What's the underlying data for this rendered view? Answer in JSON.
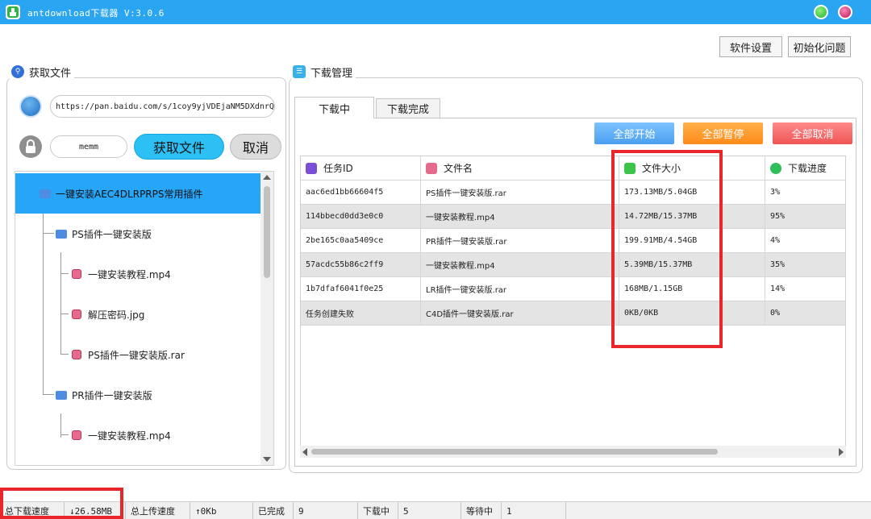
{
  "window": {
    "title": "antdownload下载器  V:3.0.6",
    "accent_color": "#2aa5f2"
  },
  "toolbar": {
    "settings_label": "软件设置",
    "init_label": "初始化问题"
  },
  "left_panel": {
    "title": "获取文件",
    "url_value": "https://pan.baidu.com/s/1coy9yjVDEjaNM5DXdnrQ",
    "password_value": "memm",
    "fetch_label": "获取文件",
    "cancel_label": "取消",
    "tree": [
      {
        "label": "一键安装AEC4DLRPRPS常用插件",
        "type": "folder"
      },
      {
        "label": "PS插件一键安装版",
        "type": "folder"
      },
      {
        "label": "一键安装教程.mp4",
        "type": "file"
      },
      {
        "label": "解压密码.jpg",
        "type": "file"
      },
      {
        "label": "PS插件一键安装版.rar",
        "type": "file"
      },
      {
        "label": "PR插件一键安装版",
        "type": "folder"
      },
      {
        "label": "一键安装教程.mp4",
        "type": "file"
      }
    ]
  },
  "right_panel": {
    "title": "下载管理",
    "tabs": [
      "下载中",
      "下载完成"
    ],
    "actions": {
      "start_all": "全部开始",
      "pause_all": "全部暂停",
      "cancel_all": "全部取消"
    },
    "columns": [
      "任务ID",
      "文件名",
      "文件大小",
      "下载进度"
    ],
    "rows": [
      [
        "aac6ed1bb66604f5",
        "PS插件一键安装版.rar",
        "173.13MB/5.04GB",
        "3%"
      ],
      [
        "114bbecd0dd3e0c0",
        "一键安装教程.mp4",
        "14.72MB/15.37MB",
        "95%"
      ],
      [
        "2be165c0aa5409ce",
        "PR插件一键安装版.rar",
        "199.91MB/4.54GB",
        "4%"
      ],
      [
        "57acdc55b86c2ff9",
        "一键安装教程.mp4",
        "5.39MB/15.37MB",
        "35%"
      ],
      [
        "1b7dfaf6041f0e25",
        "LR插件一键安装版.rar",
        "168MB/1.15GB",
        "14%"
      ],
      [
        "任务创建失败",
        "C4D插件一键安装版.rar",
        "0KB/0KB",
        "0%"
      ]
    ]
  },
  "statusbar": {
    "download_speed_label": "总下载速度",
    "download_speed_value": "↓26.58MB",
    "upload_speed_label": "总上传速度",
    "upload_speed_value": "↑0Kb",
    "done_label": "已完成",
    "done_value": "9",
    "downloading_label": "下载中",
    "downloading_value": "5",
    "waiting_label": "等待中",
    "waiting_value": "1"
  },
  "highlight_color": "#e8262b"
}
